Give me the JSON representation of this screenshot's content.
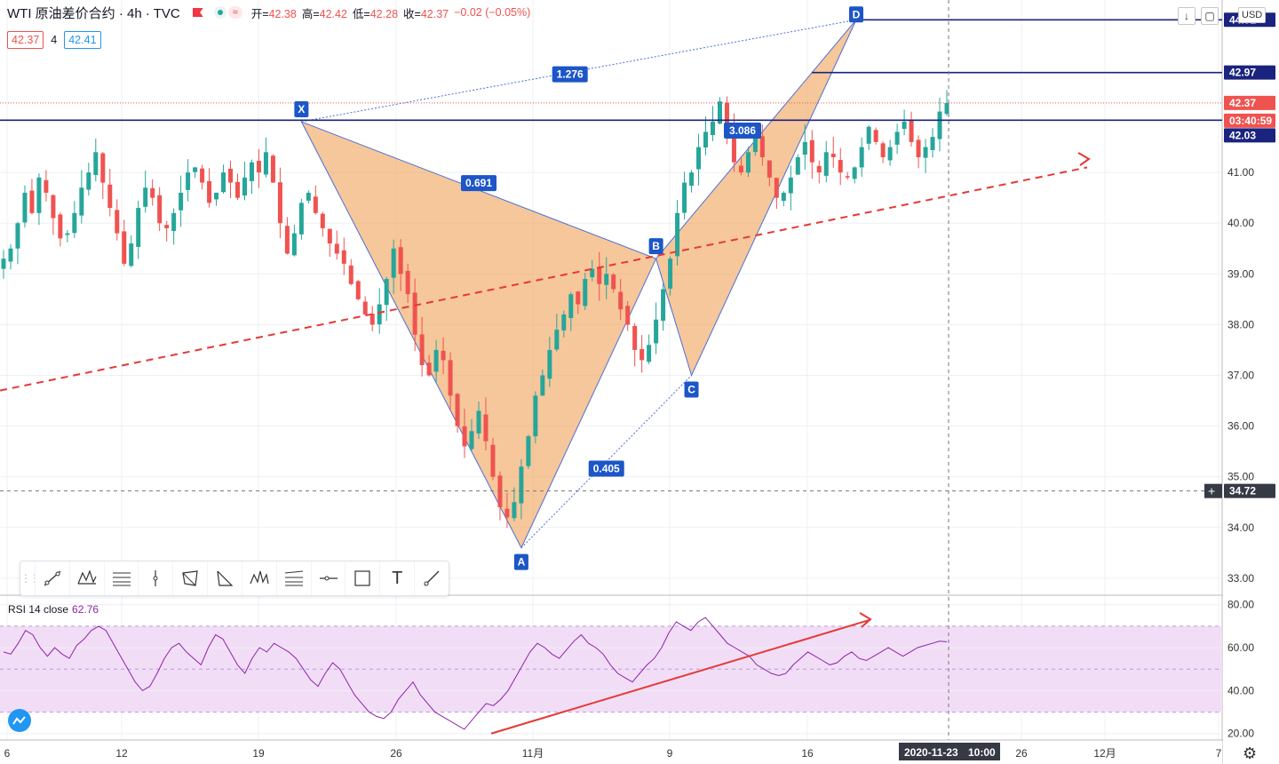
{
  "header": {
    "symbol": "WTI 原油差价合约 · 4h · TVC",
    "ohlc": [
      {
        "k": "开=",
        "v": "42.38"
      },
      {
        "k": "高=",
        "v": "42.42"
      },
      {
        "k": "低=",
        "v": "42.28"
      },
      {
        "k": "收=",
        "v": "42.37"
      },
      {
        "k": "",
        "v": "−0.02 (−0.05%)"
      }
    ],
    "bid": "42.37",
    "spread": "4",
    "ask": "42.41",
    "currency": "USD"
  },
  "colors": {
    "up": "#26a69a",
    "down": "#ef5350",
    "pattern_fill": "#f0a257",
    "pattern_line": "#4a6fd6",
    "h_line": "#1a237e",
    "trend": "#e53935",
    "rsi": "#8e24aa",
    "rsi_band": "#f2ddf7",
    "label_bg": "#1c56c7"
  },
  "chart_data": [
    {
      "type": "candlestick",
      "title": "WTI 原油差价合约 · 4h · TVC",
      "y_ticks": [
        "33.00",
        "34.00",
        "35.00",
        "36.00",
        "37.00",
        "38.00",
        "39.00",
        "40.00",
        "41.00"
      ],
      "ylim": [
        32.7,
        44.4
      ],
      "x_ticks": [
        "6",
        "12",
        "19",
        "26",
        "11月",
        "9",
        "16",
        "26",
        "12月",
        "7"
      ],
      "last_price": 42.37,
      "countdown": "03:40:59",
      "crosshair_price": "34.72",
      "crosshair_date": "2020-11-23",
      "crosshair_time": "10:00",
      "price_lines": [
        {
          "value": "44.01",
          "label": "44.01"
        },
        {
          "value": "42.97",
          "label": "42.97"
        },
        {
          "value": "42.03",
          "label": "42.03"
        }
      ],
      "pattern_points": [
        {
          "label": "X",
          "price": 42.0
        },
        {
          "label": "A",
          "price": 33.6
        },
        {
          "label": "B",
          "price": 39.3
        },
        {
          "label": "C",
          "price": 37.0
        },
        {
          "label": "D",
          "price": 44.01
        }
      ],
      "ratios": [
        "0.691",
        "0.405",
        "1.276",
        "3.086"
      ],
      "close_path": [
        39.3,
        39.5,
        40.0,
        40.6,
        40.2,
        40.9,
        40.6,
        40.1,
        39.7,
        39.8,
        40.2,
        40.7,
        41.0,
        41.4,
        40.8,
        40.3,
        39.8,
        39.2,
        39.6,
        40.3,
        40.7,
        40.5,
        40.0,
        39.9,
        40.2,
        40.6,
        41.0,
        41.1,
        40.8,
        40.4,
        40.6,
        41.0,
        40.8,
        40.5,
        40.9,
        41.2,
        41.0,
        41.4,
        40.8,
        40.0,
        39.4,
        39.8,
        40.4,
        40.6,
        40.2,
        39.9,
        39.6,
        39.4,
        39.2,
        38.8,
        38.5,
        38.2,
        38.0,
        38.4,
        38.9,
        39.5,
        39.0,
        38.6,
        37.8,
        37.2,
        37.0,
        37.5,
        37.3,
        36.6,
        36.0,
        35.6,
        35.9,
        36.3,
        35.7,
        35.0,
        34.4,
        34.2,
        34.5,
        35.2,
        35.8,
        36.6,
        37.0,
        37.5,
        37.9,
        38.2,
        38.6,
        38.4,
        38.9,
        39.1,
        38.8,
        39.0,
        38.7,
        38.3,
        38.0,
        37.5,
        37.3,
        37.6,
        38.1,
        38.7,
        39.3,
        40.2,
        40.8,
        41.0,
        41.5,
        41.8,
        42.0,
        42.4,
        41.9,
        41.2,
        41.0,
        41.4,
        41.7,
        41.3,
        40.9,
        40.5,
        40.6,
        40.9,
        41.3,
        41.6,
        41.2,
        41.0,
        41.4,
        41.3,
        41.0,
        40.9,
        41.1,
        41.5,
        41.9,
        41.6,
        41.3,
        41.5,
        41.8,
        42.0,
        41.6,
        41.3,
        41.5,
        41.7,
        42.2,
        42.37
      ]
    },
    {
      "type": "line",
      "title": "RSI 14 close",
      "last_value": "62.76",
      "y_ticks": [
        "20.00",
        "40.00",
        "60.00",
        "80.00"
      ],
      "ylim": [
        17,
        84
      ],
      "band": [
        30,
        70
      ],
      "values": [
        58,
        57,
        62,
        68,
        66,
        60,
        56,
        60,
        57,
        55,
        61,
        64,
        68,
        70,
        68,
        62,
        56,
        50,
        44,
        40,
        42,
        48,
        55,
        60,
        62,
        58,
        55,
        52,
        60,
        66,
        64,
        58,
        52,
        48,
        55,
        60,
        58,
        62,
        60,
        58,
        55,
        50,
        45,
        42,
        48,
        53,
        50,
        44,
        38,
        34,
        30,
        28,
        27,
        30,
        36,
        40,
        44,
        38,
        34,
        30,
        28,
        26,
        24,
        22,
        26,
        30,
        34,
        33,
        36,
        40,
        46,
        52,
        58,
        62,
        60,
        57,
        55,
        59,
        63,
        66,
        62,
        60,
        57,
        52,
        48,
        46,
        44,
        48,
        52,
        55,
        60,
        67,
        72,
        70,
        68,
        72,
        74,
        70,
        66,
        62,
        60,
        58,
        56,
        52,
        50,
        48,
        47,
        48,
        52,
        55,
        58,
        56,
        54,
        52,
        53,
        56,
        58,
        55,
        54,
        56,
        58,
        60,
        58,
        56,
        58,
        60,
        61,
        62,
        63,
        62.76
      ]
    }
  ],
  "toolbar": {
    "tools": [
      "trend-line-icon",
      "xabcd-pattern-icon",
      "fib-retracement-icon",
      "vertical-line-icon",
      "polygon-icon",
      "triangle-pattern-icon",
      "head-shoulders-icon",
      "fib-channel-icon",
      "horizontal-line-icon",
      "rectangle-icon",
      "text-icon",
      "ray-icon"
    ],
    "text_tool": "T"
  }
}
